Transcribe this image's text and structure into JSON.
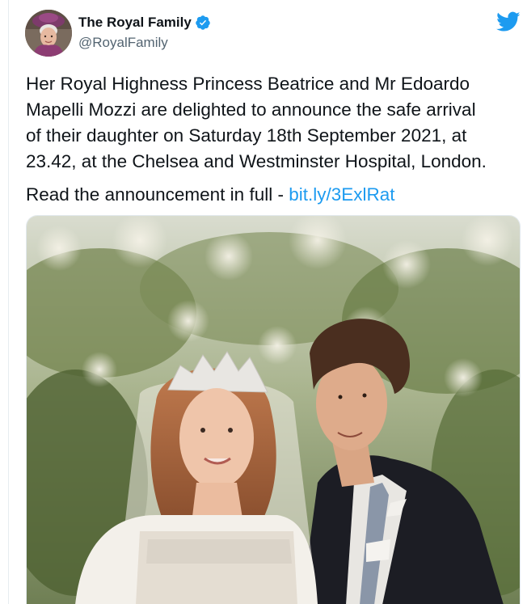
{
  "tweet": {
    "display_name": "The Royal Family",
    "handle": "@RoyalFamily",
    "text": "Her Royal Highness Princess Beatrice and Mr Edoardo\nMapelli Mozzi are delighted to announce the safe arrival\nof their daughter on Saturday 18th September 2021, at\n23.42, at the Chelsea and Westminster Hospital, London.",
    "read_prefix": "Read the announcement in full - ",
    "link_text": "bit.ly/3ExlRat"
  },
  "icons": {
    "avatar": "profile-avatar",
    "verified": "verified-badge-icon",
    "brand": "twitter-bird-icon"
  },
  "colors": {
    "accent": "#1d9bf0",
    "text": "#0f1419",
    "secondary_text": "#536471"
  }
}
